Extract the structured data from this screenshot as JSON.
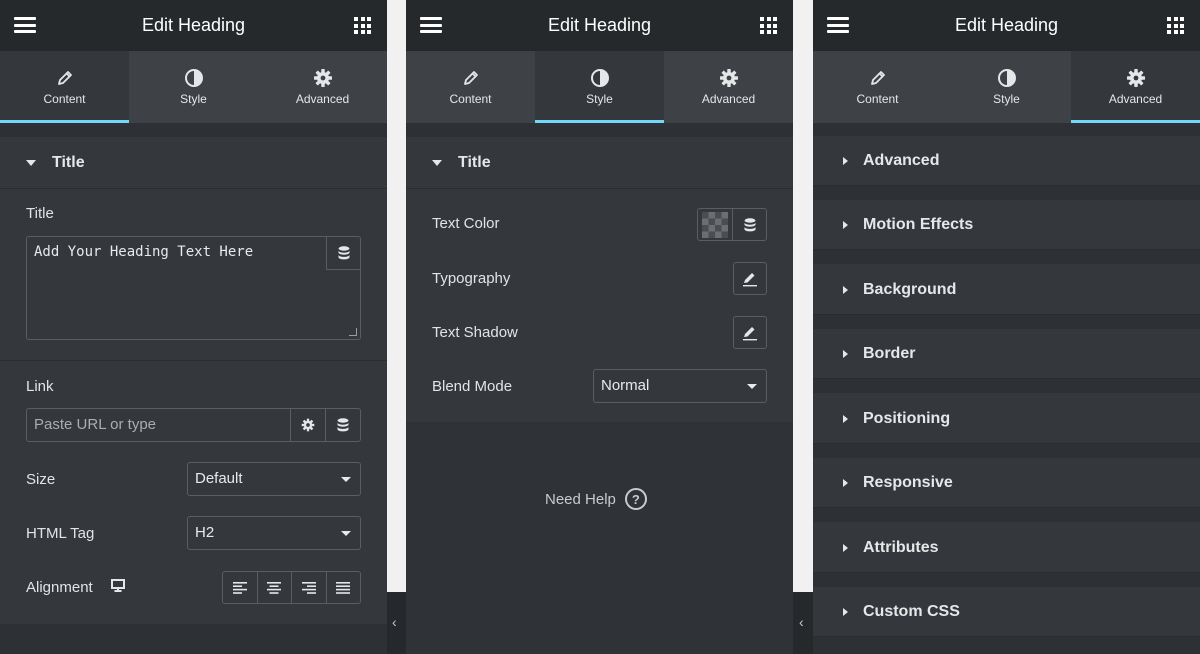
{
  "panels": [
    {
      "header_title": "Edit Heading",
      "tabs": [
        {
          "label": "Content",
          "icon": "pencil-icon"
        },
        {
          "label": "Style",
          "icon": "half-circle-icon"
        },
        {
          "label": "Advanced",
          "icon": "gear-icon"
        }
      ],
      "active_tab": "Content"
    },
    {
      "header_title": "Edit Heading",
      "tabs": [
        {
          "label": "Content",
          "icon": "pencil-icon"
        },
        {
          "label": "Style",
          "icon": "half-circle-icon"
        },
        {
          "label": "Advanced",
          "icon": "gear-icon"
        }
      ],
      "active_tab": "Style"
    },
    {
      "header_title": "Edit Heading",
      "tabs": [
        {
          "label": "Content",
          "icon": "pencil-icon"
        },
        {
          "label": "Style",
          "icon": "half-circle-icon"
        },
        {
          "label": "Advanced",
          "icon": "gear-icon"
        }
      ],
      "active_tab": "Advanced"
    }
  ],
  "content": {
    "section_title": "Title",
    "title_label": "Title",
    "title_value": "Add Your Heading Text Here",
    "link_label": "Link",
    "link_placeholder": "Paste URL or type",
    "size_label": "Size",
    "size_value": "Default",
    "html_tag_label": "HTML Tag",
    "html_tag_value": "H2",
    "alignment_label": "Alignment"
  },
  "style": {
    "section_title": "Title",
    "text_color_label": "Text Color",
    "typography_label": "Typography",
    "text_shadow_label": "Text Shadow",
    "blend_mode_label": "Blend Mode",
    "blend_mode_value": "Normal",
    "help_text": "Need Help",
    "help_icon": "?"
  },
  "advanced": {
    "sections": [
      "Advanced",
      "Motion Effects",
      "Background",
      "Border",
      "Positioning",
      "Responsive",
      "Attributes",
      "Custom CSS"
    ]
  },
  "colors": {
    "panel_bg": "#34383c",
    "header_bg": "#26292c",
    "tab_bg": "#3e4247",
    "active_indicator": "#71d7f7",
    "border": "#5a5e63"
  }
}
